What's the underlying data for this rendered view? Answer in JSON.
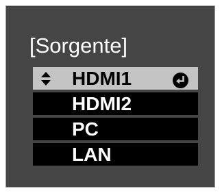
{
  "menu": {
    "title": "[Sorgente]",
    "items": [
      {
        "label": "HDMI1",
        "selected": true,
        "icons": [
          "up-down-arrow-icon",
          "enter-icon"
        ]
      },
      {
        "label": "HDMI2",
        "selected": false
      },
      {
        "label": "PC",
        "selected": false
      },
      {
        "label": "LAN",
        "selected": false
      }
    ]
  },
  "colors": {
    "panel_background": "#454545",
    "item_background": "#000000",
    "selected_background": "#c4c4c4",
    "text": "#ffffff"
  }
}
